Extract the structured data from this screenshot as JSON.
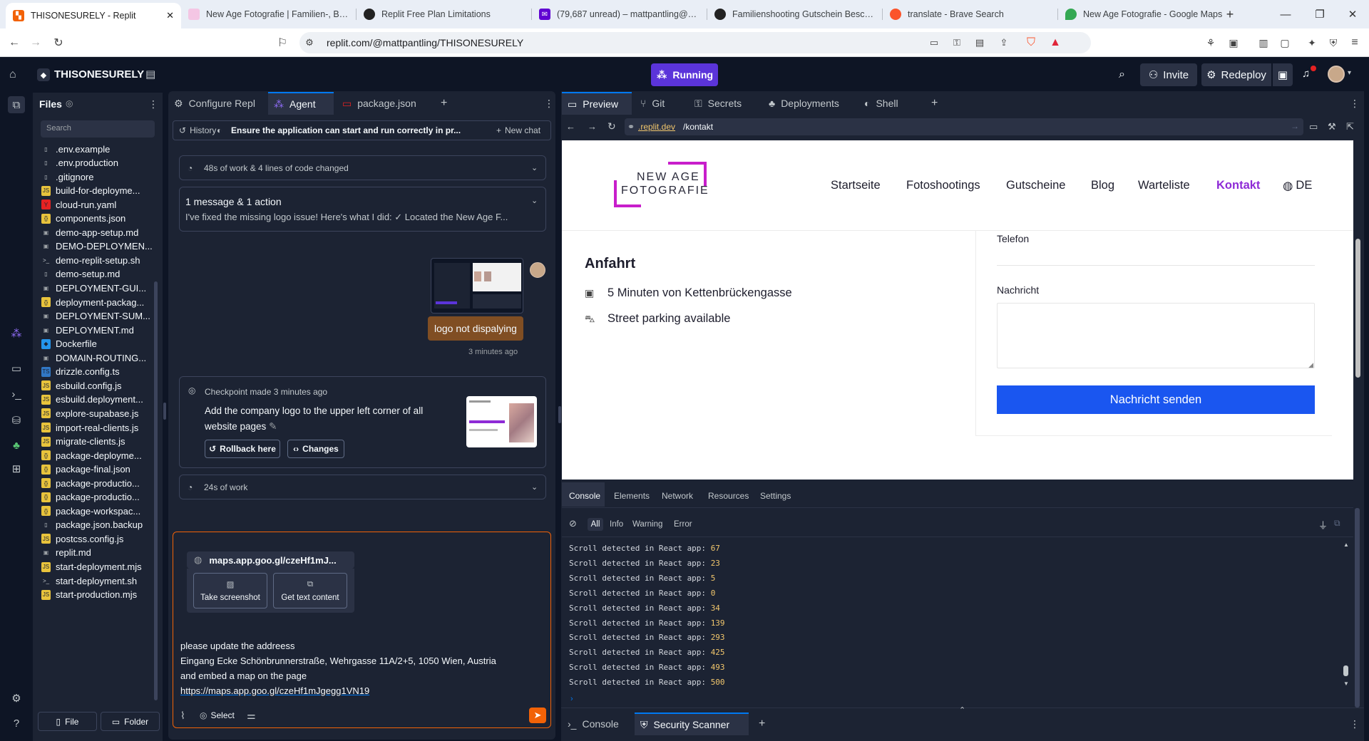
{
  "browser": {
    "tabs": [
      {
        "label": "THISONESURELY - Replit",
        "active": true
      },
      {
        "label": "New Age Fotografie | Familien-, Baby"
      },
      {
        "label": "Replit Free Plan Limitations"
      },
      {
        "label": "(79,687 unread) – mattpantling@yah"
      },
      {
        "label": "Familienshooting Gutschein Beschre"
      },
      {
        "label": "translate - Brave Search"
      },
      {
        "label": "New Age Fotografie - Google Maps"
      }
    ],
    "url": "replit.com/@mattpantling/THISONESURELY"
  },
  "header": {
    "project_name": "THISONESURELY",
    "status": "Running",
    "invite_label": "Invite",
    "redeploy_label": "Redeploy"
  },
  "files": {
    "title": "Files",
    "search_placeholder": "Search",
    "items": [
      {
        "name": ".env.example",
        "type": "doc"
      },
      {
        "name": ".env.production",
        "type": "doc"
      },
      {
        "name": ".gitignore",
        "type": "doc"
      },
      {
        "name": "build-for-deployme...",
        "type": "js"
      },
      {
        "name": "cloud-run.yaml",
        "type": "yaml"
      },
      {
        "name": "components.json",
        "type": "json"
      },
      {
        "name": "demo-app-setup.md",
        "type": "md"
      },
      {
        "name": "DEMO-DEPLOYMEN...",
        "type": "md"
      },
      {
        "name": "demo-replit-setup.sh",
        "type": "sh"
      },
      {
        "name": "demo-setup.md",
        "type": "doc"
      },
      {
        "name": "DEPLOYMENT-GUI...",
        "type": "md"
      },
      {
        "name": "deployment-packag...",
        "type": "json"
      },
      {
        "name": "DEPLOYMENT-SUM...",
        "type": "md"
      },
      {
        "name": "DEPLOYMENT.md",
        "type": "md"
      },
      {
        "name": "Dockerfile",
        "type": "docker"
      },
      {
        "name": "DOMAIN-ROUTING...",
        "type": "md"
      },
      {
        "name": "drizzle.config.ts",
        "type": "ts"
      },
      {
        "name": "esbuild.config.js",
        "type": "js"
      },
      {
        "name": "esbuild.deployment...",
        "type": "js"
      },
      {
        "name": "explore-supabase.js",
        "type": "js"
      },
      {
        "name": "import-real-clients.js",
        "type": "js"
      },
      {
        "name": "migrate-clients.js",
        "type": "js"
      },
      {
        "name": "package-deployme...",
        "type": "json"
      },
      {
        "name": "package-final.json",
        "type": "json"
      },
      {
        "name": "package-productio...",
        "type": "json"
      },
      {
        "name": "package-productio...",
        "type": "json"
      },
      {
        "name": "package-workspac...",
        "type": "json"
      },
      {
        "name": "package.json.backup",
        "type": "doc"
      },
      {
        "name": "postcss.config.js",
        "type": "js"
      },
      {
        "name": "replit.md",
        "type": "md"
      },
      {
        "name": "start-deployment.mjs",
        "type": "js"
      },
      {
        "name": "start-deployment.sh",
        "type": "sh"
      },
      {
        "name": "start-production.mjs",
        "type": "js"
      }
    ],
    "new_file_label": "File",
    "new_folder_label": "Folder"
  },
  "left_tabs": [
    {
      "label": "Configure Repl"
    },
    {
      "label": "Agent"
    },
    {
      "label": "package.json"
    }
  ],
  "agent": {
    "history_label": "History",
    "chat_title": "Ensure the application can start and run correctly in pr...",
    "new_chat_label": "New chat",
    "work_summary": "48s of work & 4 lines of code changed",
    "message_header": "1 message & 1 action",
    "message_preview": "I've fixed the missing logo issue! Here's what I did: ✓ Located the New Age F...",
    "user_message": "logo not dispalying",
    "user_message_time": "3 minutes ago",
    "checkpoint_label": "Checkpoint made 3 minutes ago",
    "checkpoint_desc": "Add the company logo to the upper left corner of all website pages",
    "rollback_label": "Rollback here",
    "changes_label": "Changes",
    "work2": "24s of work",
    "link_chip": "maps.app.goo.gl/czeHf1mJ...",
    "take_screenshot": "Take screenshot",
    "get_text": "Get text content",
    "input_line1": "please update the addreess",
    "input_line2": "Eingang Ecke Schönbrunnerstraße, Wehrgasse 11A/2+5, 1050 Wien, Austria",
    "input_line3": "and embed a map on the page",
    "input_link": "https://maps.app.goo.gl/czeHf1mJgegg1VN19",
    "select_label": "Select"
  },
  "right_tabs": [
    {
      "label": "Preview"
    },
    {
      "label": "Git"
    },
    {
      "label": "Secrets"
    },
    {
      "label": "Deployments"
    },
    {
      "label": "Shell"
    }
  ],
  "preview": {
    "url_prefix": ".replit.dev",
    "url_path": "/kontakt"
  },
  "site": {
    "logo_line1": "NEW AGE",
    "logo_line2": "FOTOGRAFIE",
    "nav": [
      "Startseite",
      "Fotoshootings",
      "Gutscheine",
      "Blog",
      "Warteliste",
      "Kontakt"
    ],
    "lang": "DE",
    "anfahrt_title": "Anfahrt",
    "anfahrt_1": "5 Minuten von Kettenbrückengasse",
    "anfahrt_2": "Street parking available",
    "telefon_label": "Telefon",
    "nachricht_label": "Nachricht",
    "submit_label": "Nachricht senden",
    "accent": "#8e2bd6",
    "button_color": "#1a56f0"
  },
  "devtools": {
    "tabs": [
      "Console",
      "Elements",
      "Network",
      "Resources",
      "Settings"
    ],
    "filters": [
      "All",
      "Info",
      "Warning",
      "Error"
    ],
    "log_prefix": "Scroll detected in React app:",
    "log_values": [
      "67",
      "23",
      "5",
      "0",
      "34",
      "139",
      "293",
      "425",
      "493",
      "500"
    ]
  },
  "bottom_tabs": [
    {
      "label": "Console"
    },
    {
      "label": "Security Scanner"
    }
  ]
}
